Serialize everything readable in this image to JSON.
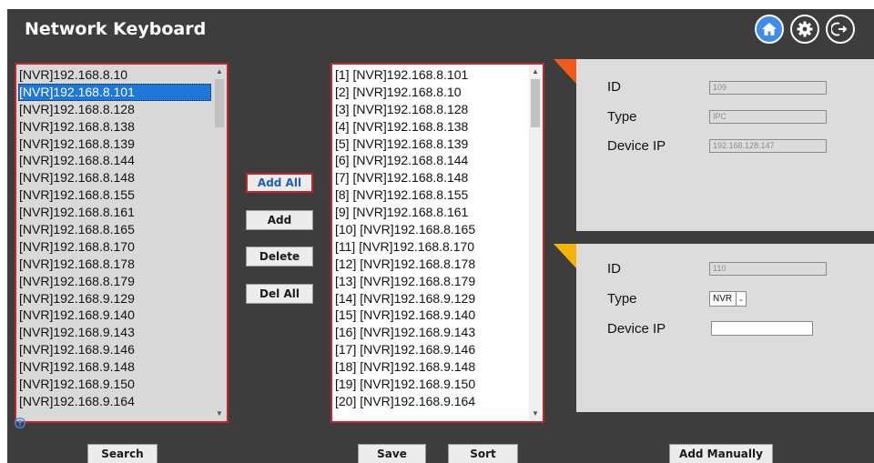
{
  "app": {
    "title": "Network Keyboard"
  },
  "icons": {
    "home": "home-icon",
    "settings": "gear-icon",
    "logout": "logout-icon",
    "help": "help-icon"
  },
  "colors": {
    "accent": "#3d8ee8",
    "border_red": "#c2262c",
    "corner_orange": "#f25a1b",
    "corner_yellow": "#f5b400",
    "selection": "#1e78d8"
  },
  "device_list": {
    "items": [
      "[NVR]192.168.8.10",
      "[NVR]192.168.8.101",
      "[NVR]192.168.8.128",
      "[NVR]192.168.8.138",
      "[NVR]192.168.8.139",
      "[NVR]192.168.8.144",
      "[NVR]192.168.8.148",
      "[NVR]192.168.8.155",
      "[NVR]192.168.8.161",
      "[NVR]192.168.8.165",
      "[NVR]192.168.8.170",
      "[NVR]192.168.8.178",
      "[NVR]192.168.8.179",
      "[NVR]192.168.9.129",
      "[NVR]192.168.9.140",
      "[NVR]192.168.9.143",
      "[NVR]192.168.9.146",
      "[NVR]192.168.9.148",
      "[NVR]192.168.9.150",
      "[NVR]192.168.9.164"
    ],
    "selected_index": 1
  },
  "added_list": {
    "items": [
      "[1] [NVR]192.168.8.101",
      "[2] [NVR]192.168.8.10",
      "[3] [NVR]192.168.8.128",
      "[4] [NVR]192.168.8.138",
      "[5] [NVR]192.168.8.139",
      "[6] [NVR]192.168.8.144",
      "[7] [NVR]192.168.8.148",
      "[8] [NVR]192.168.8.155",
      "[9] [NVR]192.168.8.161",
      "[10] [NVR]192.168.8.165",
      "[11] [NVR]192.168.8.170",
      "[12] [NVR]192.168.8.178",
      "[13] [NVR]192.168.8.179",
      "[14] [NVR]192.168.9.129",
      "[15] [NVR]192.168.9.140",
      "[16] [NVR]192.168.9.143",
      "[17] [NVR]192.168.9.146",
      "[18] [NVR]192.168.9.148",
      "[19] [NVR]192.168.9.150",
      "[20] [NVR]192.168.9.164"
    ]
  },
  "middle_buttons": {
    "add_all": "Add All",
    "add": "Add",
    "delete": "Delete",
    "del_all": "Del All"
  },
  "panel1": {
    "id_label": "ID",
    "id_value": "109",
    "type_label": "Type",
    "type_value": "IPC",
    "ip_label": "Device IP",
    "ip_value": "192.168.128.147"
  },
  "panel2": {
    "id_label": "ID",
    "id_value": "110",
    "type_label": "Type",
    "type_value": "NVR",
    "ip_label": "Device IP",
    "ip_value": ""
  },
  "bottom_buttons": {
    "search": "Search",
    "save": "Save",
    "sort": "Sort",
    "add_manually": "Add Manually"
  }
}
